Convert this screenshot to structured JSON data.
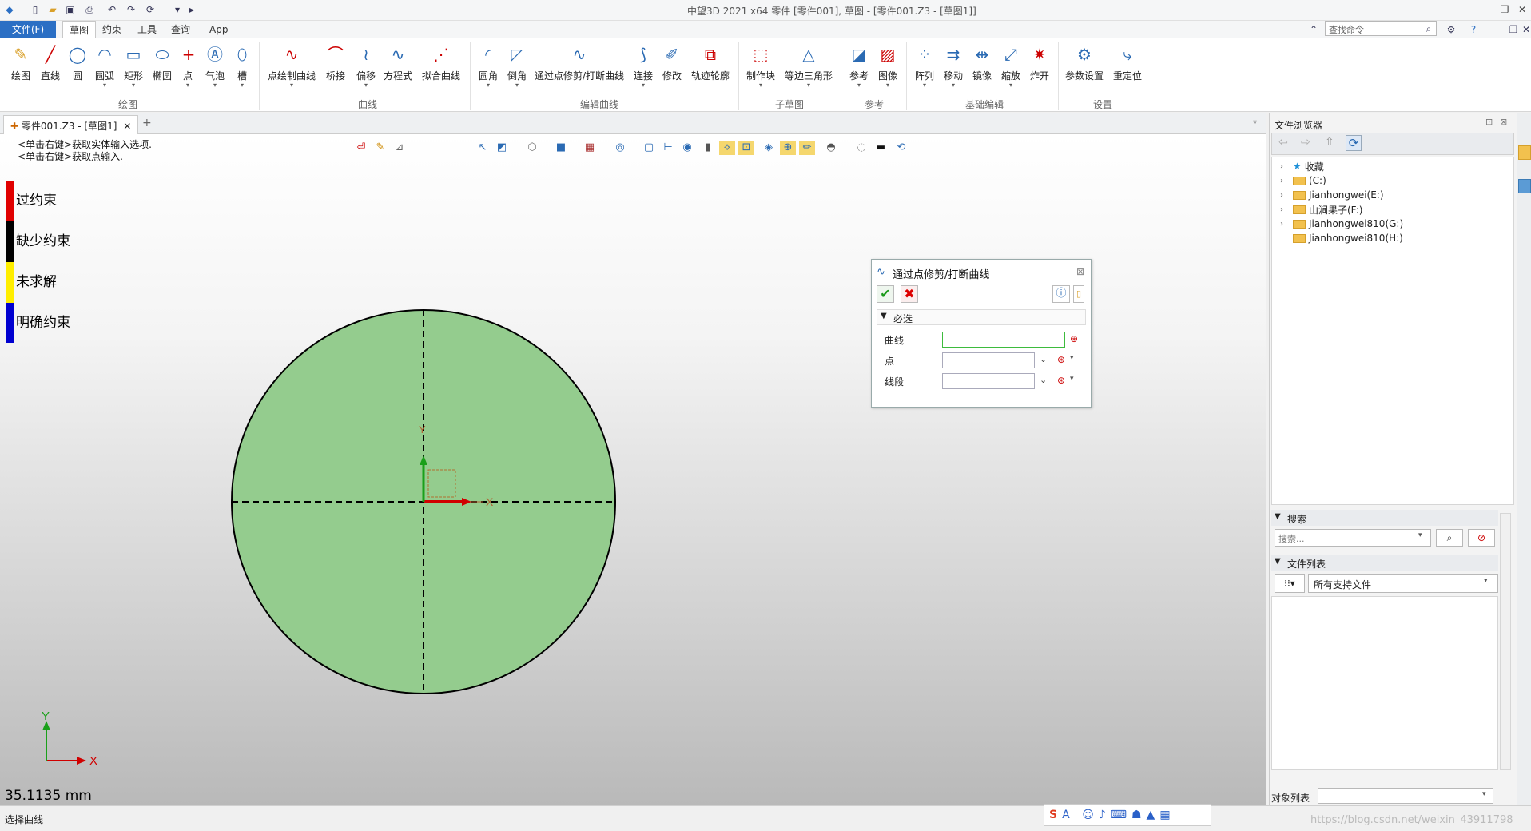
{
  "app": {
    "title": "中望3D 2021 x64      零件 [零件001], 草图 - [零件001.Z3 - [草图1]]"
  },
  "quick_access": [
    "new-icon",
    "open-icon",
    "save-icon",
    "print-icon",
    "undo-icon",
    "redo-icon",
    "sync-icon",
    "dropdown-icon",
    "play-icon"
  ],
  "menu": {
    "file": "文件(F)",
    "tabs": [
      "草图",
      "约束",
      "工具",
      "查询",
      "App"
    ],
    "search_placeholder": "查找命令"
  },
  "ribbon": {
    "groups": [
      {
        "label": "绘图",
        "buttons": [
          "绘图",
          "直线",
          "圆",
          "圆弧",
          "矩形",
          "椭圆",
          "点",
          "气泡",
          "槽"
        ]
      },
      {
        "label": "曲线",
        "buttons": [
          "点绘制曲线",
          "桥接",
          "偏移",
          "方程式",
          "拟合曲线"
        ]
      },
      {
        "label": "编辑曲线",
        "buttons": [
          "圆角",
          "倒角",
          "通过点修剪/打断曲线",
          "连接",
          "修改",
          "轨迹轮廓"
        ]
      },
      {
        "label": "子草图",
        "buttons": [
          "制作块",
          "等边三角形"
        ]
      },
      {
        "label": "参考",
        "buttons": [
          "参考",
          "图像"
        ]
      },
      {
        "label": "基础编辑",
        "buttons": [
          "阵列",
          "移动",
          "镜像",
          "缩放",
          "炸开"
        ]
      },
      {
        "label": "设置",
        "buttons": [
          "参数设置",
          "重定位"
        ]
      }
    ]
  },
  "doc_tab": {
    "label": "零件001.Z3 - [草图1]",
    "add": "+",
    "close": "✕"
  },
  "viewport": {
    "hints": [
      "<单击右键>获取实体输入选项.",
      "<单击右键>获取点输入."
    ],
    "legend": [
      {
        "label": "过约束",
        "color": "#e00000"
      },
      {
        "label": "缺少约束",
        "color": "#000000"
      },
      {
        "label": "未求解",
        "color": "#ffee00"
      },
      {
        "label": "明确约束",
        "color": "#0000d0"
      }
    ],
    "measure": "35.1135 mm",
    "triad": {
      "x": "X",
      "y": "Y"
    },
    "sketch_axis": {
      "x": "X",
      "y": "Y"
    },
    "circle_fill": "#94cc8e"
  },
  "dialog": {
    "title": "通过点修剪/打断曲线",
    "section": "必选",
    "fields": [
      {
        "label": "曲线",
        "value": ""
      },
      {
        "label": "点",
        "value": ""
      },
      {
        "label": "线段",
        "value": ""
      }
    ]
  },
  "file_browser": {
    "title": "文件浏览器",
    "tree": [
      "收藏",
      "(C:)",
      "Jianhongwei(E:)",
      "山涧果子(F:)",
      "Jianhongwei810(G:)",
      "Jianhongwei810(H:)"
    ],
    "search_section": "搜索",
    "search_placeholder": "搜索...",
    "file_list_section": "文件列表",
    "file_filter": "所有支持文件",
    "object_list_label": "对象列表"
  },
  "status": {
    "text": "选择曲线",
    "watermark": "https://blog.csdn.net/weixin_43911798"
  }
}
